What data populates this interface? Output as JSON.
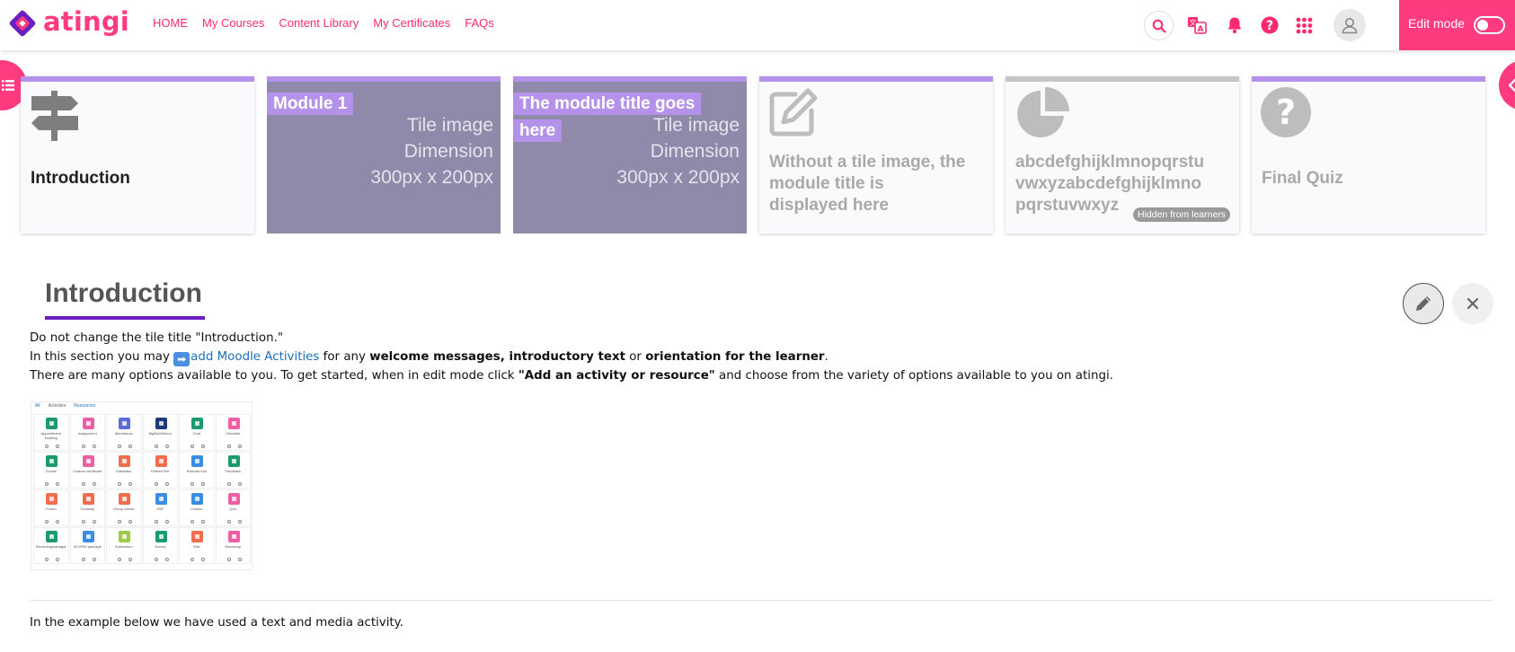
{
  "brand": {
    "name": "atingi",
    "accent": "#ff3b7f",
    "tile_accent": "#b592ea",
    "underline": "#6a1fc2"
  },
  "nav": [
    {
      "label": "HOME"
    },
    {
      "label": "My Courses"
    },
    {
      "label": "Content Library"
    },
    {
      "label": "My Certificates"
    },
    {
      "label": "FAQs"
    }
  ],
  "header_icons": [
    "search-icon",
    "translate-icon",
    "bell-icon",
    "help-icon",
    "apps-grid-icon",
    "user-avatar-icon"
  ],
  "edit_mode": {
    "label": "Edit mode",
    "enabled": false
  },
  "tiles": [
    {
      "title": "Introduction",
      "icon": "signpost-icon",
      "state": "active"
    },
    {
      "title": "Module 1",
      "image_text": [
        "Tile image",
        "Dimension",
        "300px x 200px"
      ]
    },
    {
      "title": "The module title goes here",
      "image_text": [
        "Tile image",
        "Dimension",
        "300px x 200px"
      ]
    },
    {
      "title": "Without a tile image, the module title is displayed here",
      "icon": "edit-icon"
    },
    {
      "title": "abcdefghijklmnopqrstu vwxyzabcdefghijklmno pqrstuvwxyz",
      "icon": "pie-chart-icon",
      "badge": "Hidden from learners"
    },
    {
      "title": "Final Quiz",
      "icon": "question-icon"
    }
  ],
  "section": {
    "title": "Introduction",
    "line1": "Do not change the tile title \"Introduction.\"",
    "line2": {
      "prefix": "In this section you may ",
      "link": "add Moodle Activities",
      "mid1": " for any ",
      "bold1": "welcome messages, introductory text",
      "mid2": " or ",
      "bold2": "orientation for the learner",
      "end": "."
    },
    "line3": {
      "prefix": "There are many options available to you. To get started, when in edit mode click ",
      "bold": "\"Add an activity or resource\"",
      "end": " and choose from the variety of options available to you on atingi."
    },
    "footer": "In the example below we have used a text and media activity."
  },
  "chooser": {
    "tabs": [
      "All",
      "Activities",
      "Resources"
    ],
    "items": [
      {
        "name": "Appointment booking",
        "color": "#1c9a6c"
      },
      {
        "name": "Assignment",
        "color": "#ec5fa5"
      },
      {
        "name": "Attendance",
        "color": "#5b6cd8"
      },
      {
        "name": "BigBlueButton",
        "color": "#1b3a7a"
      },
      {
        "name": "Chat",
        "color": "#1c9a6c"
      },
      {
        "name": "Checklist",
        "color": "#ec5fa5"
      },
      {
        "name": "Choice",
        "color": "#1c9a6c"
      },
      {
        "name": "Custom certificate",
        "color": "#ec5fa5"
      },
      {
        "name": "Database",
        "color": "#f06e4e"
      },
      {
        "name": "Embed File",
        "color": "#f06e4e"
      },
      {
        "name": "External tool",
        "color": "#3a8de0"
      },
      {
        "name": "Feedback",
        "color": "#1c9a6c"
      },
      {
        "name": "Forum",
        "color": "#f06e4e"
      },
      {
        "name": "Glossary",
        "color": "#f06e4e"
      },
      {
        "name": "Group choice",
        "color": "#f06e4e"
      },
      {
        "name": "H5P",
        "color": "#3a8de0"
      },
      {
        "name": "Lesson",
        "color": "#3a8de0"
      },
      {
        "name": "Quiz",
        "color": "#ec5fa5"
      },
      {
        "name": "Recordingmanager",
        "color": "#1c9a6c"
      },
      {
        "name": "SCORM package",
        "color": "#3a8de0"
      },
      {
        "name": "Subsection",
        "color": "#9ecb4a"
      },
      {
        "name": "Survey",
        "color": "#1c9a6c"
      },
      {
        "name": "Wiki",
        "color": "#f06e4e"
      },
      {
        "name": "Workshop",
        "color": "#ec5fa5"
      }
    ]
  }
}
